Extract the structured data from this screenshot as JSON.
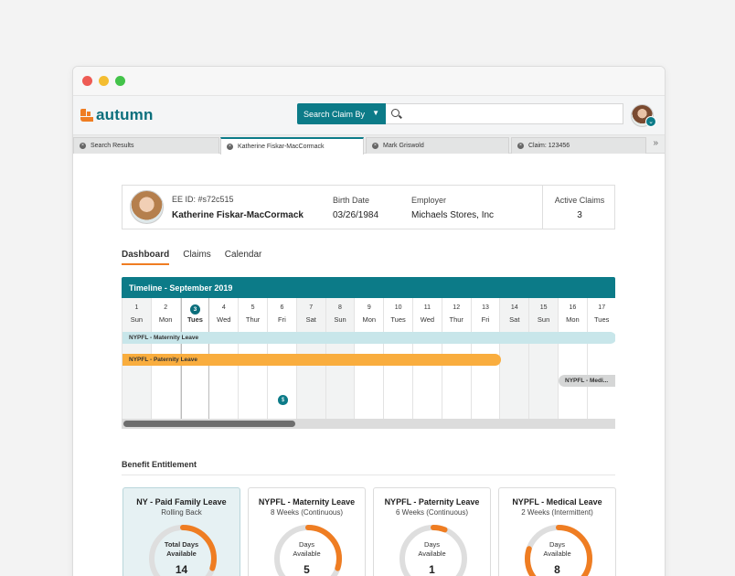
{
  "app": {
    "name": "autumn"
  },
  "colors": {
    "teal": "#0c7b88",
    "orange": "#ef7d22",
    "maternity": "#c8e6ea",
    "paternity": "#f9ad3e",
    "medical": "#d5d6d6"
  },
  "search": {
    "button_label": "Search Claim By",
    "value": ""
  },
  "tabs": [
    {
      "label": "Search Results",
      "active": false
    },
    {
      "label": "Katherine Fiskar-MacCormack",
      "active": true
    },
    {
      "label": "Mark Griswold",
      "active": false
    },
    {
      "label": "Claim: 123456",
      "active": false
    }
  ],
  "employee": {
    "ee_id": "EE ID: #s72c515",
    "name": "Katherine Fiskar-MacCormack",
    "birth_date_label": "Birth Date",
    "birth_date": "03/26/1984",
    "employer_label": "Employer",
    "employer": "Michaels Stores, Inc",
    "active_claims_label": "Active Claims",
    "active_claims": "3"
  },
  "nav": [
    "Dashboard",
    "Claims",
    "Calendar"
  ],
  "timeline": {
    "title": "Timeline - September 2019",
    "today": "3",
    "days": [
      {
        "num": "1",
        "name": "Sun"
      },
      {
        "num": "2",
        "name": "Mon"
      },
      {
        "num": "3",
        "name": "Tues"
      },
      {
        "num": "4",
        "name": "Wed"
      },
      {
        "num": "5",
        "name": "Thur"
      },
      {
        "num": "6",
        "name": "Fri"
      },
      {
        "num": "7",
        "name": "Sat"
      },
      {
        "num": "8",
        "name": "Sun"
      },
      {
        "num": "9",
        "name": "Mon"
      },
      {
        "num": "10",
        "name": "Tues"
      },
      {
        "num": "11",
        "name": "Wed"
      },
      {
        "num": "12",
        "name": "Thur"
      },
      {
        "num": "13",
        "name": "Fri"
      },
      {
        "num": "14",
        "name": "Sat"
      },
      {
        "num": "15",
        "name": "Sun"
      },
      {
        "num": "16",
        "name": "Mon"
      },
      {
        "num": "17",
        "name": "Tues"
      }
    ],
    "bars": {
      "maternity": "NYPFL - Maternity Leave",
      "paternity": "NYPFL - Paternity Leave",
      "medical": "NYPFL - Medi..."
    }
  },
  "benefits": {
    "title": "Benefit Entitlement",
    "cards": [
      {
        "title": "NY - Paid Family Leave",
        "sub": "Rolling Back",
        "label1": "Total Days",
        "label2": "Available",
        "value": "14",
        "progress": 0.3,
        "highlight": true
      },
      {
        "title": "NYPFL - Maternity Leave",
        "sub": "8 Weeks (Continuous)",
        "label1": "Days",
        "label2": "Available",
        "value": "5",
        "progress": 0.3,
        "highlight": false
      },
      {
        "title": "NYPFL - Paternity Leave",
        "sub": "6 Weeks (Continuous)",
        "label1": "Days",
        "label2": "Available",
        "value": "1",
        "progress": 0.06,
        "highlight": false
      },
      {
        "title": "NYPFL - Medical Leave",
        "sub": "2 Weeks (Intermittent)",
        "label1": "Days",
        "label2": "Available",
        "value": "8",
        "progress": 0.8,
        "highlight": false
      }
    ]
  }
}
